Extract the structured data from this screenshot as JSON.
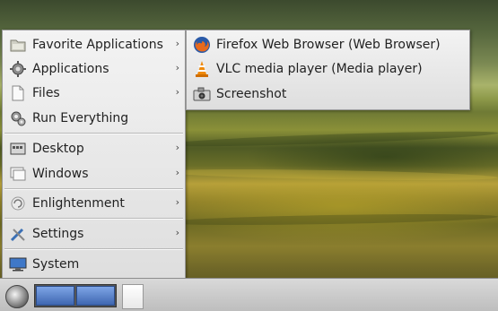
{
  "main_menu": {
    "items": [
      {
        "label": "Favorite Applications",
        "icon": "folder-icon",
        "has_submenu": true
      },
      {
        "label": "Applications",
        "icon": "gear-icon",
        "has_submenu": true
      },
      {
        "label": "Files",
        "icon": "file-icon",
        "has_submenu": true
      },
      {
        "label": "Run Everything",
        "icon": "run-gears-icon",
        "has_submenu": false
      },
      {
        "label": "Desktop",
        "icon": "desktop-icon",
        "has_submenu": true
      },
      {
        "label": "Windows",
        "icon": "windows-icon",
        "has_submenu": true
      },
      {
        "label": "Enlightenment",
        "icon": "enlightenment-icon",
        "has_submenu": true
      },
      {
        "label": "Settings",
        "icon": "settings-icon",
        "has_submenu": true
      },
      {
        "label": "System",
        "icon": "monitor-icon",
        "has_submenu": false
      }
    ]
  },
  "submenu": {
    "items": [
      {
        "label": "Firefox Web Browser (Web Browser)",
        "icon": "firefox-icon"
      },
      {
        "label": "VLC media player (Media player)",
        "icon": "vlc-cone-icon"
      },
      {
        "label": "Screenshot",
        "icon": "camera-icon"
      }
    ]
  },
  "arrow_glyph": "›",
  "colors": {
    "menu_bg": "#e8e8e8",
    "pager_active": "#5a82cc"
  }
}
